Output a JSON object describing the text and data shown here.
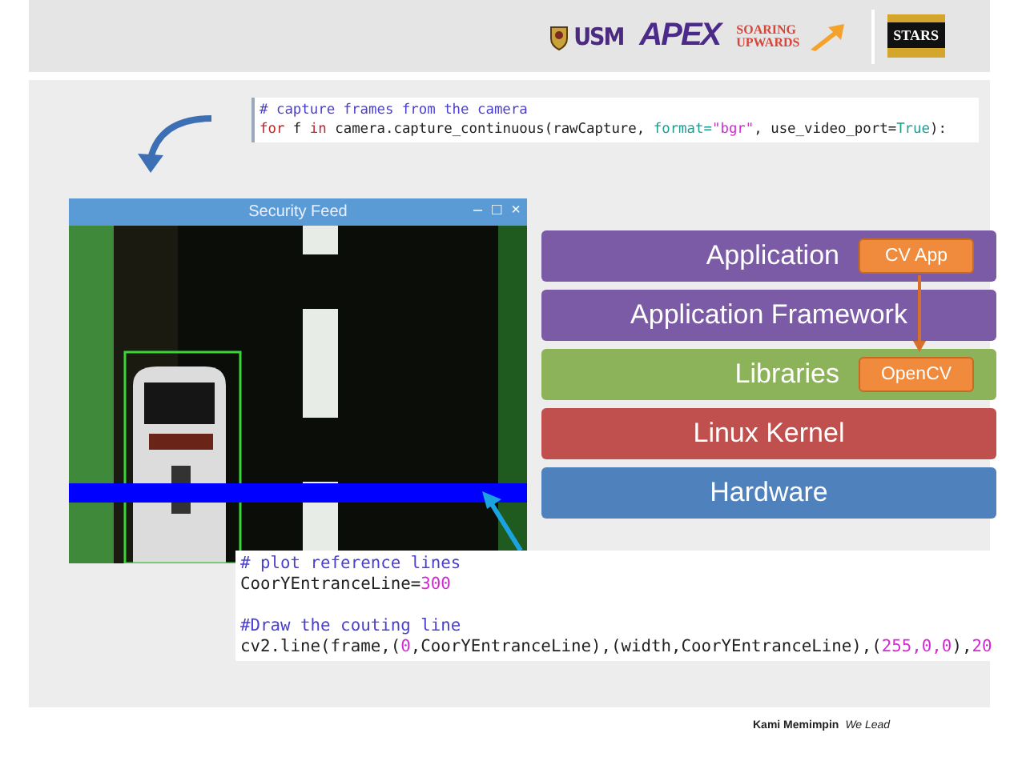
{
  "header": {
    "logos": [
      {
        "kind": "crest",
        "text": "USM"
      },
      {
        "kind": "apex",
        "text": "APEX"
      },
      {
        "kind": "soaring",
        "text": "SOARING UPWARDS"
      },
      {
        "kind": "stars",
        "text": "STARS"
      }
    ]
  },
  "code_top": {
    "blocks": [
      {
        "lines": [
          [
            {
              "kind": "comment",
              "text": "# capture frames from the camera"
            }
          ],
          [
            {
              "kind": "keyword",
              "text": "for"
            },
            {
              "kind": "plain",
              "text": " f "
            },
            {
              "kind": "keyword",
              "text": "in"
            },
            {
              "kind": "plain",
              "text": " camera.capture_continuous(rawCapture, "
            },
            {
              "kind": "param",
              "text": "format="
            },
            {
              "kind": "string",
              "text": "\"bgr\""
            },
            {
              "kind": "plain",
              "text": ", use_video_port="
            },
            {
              "kind": "param",
              "text": "True"
            },
            {
              "kind": "plain",
              "text": "):"
            }
          ]
        ]
      }
    ]
  },
  "feed_window": {
    "title": "Security Feed",
    "controls": [
      "–",
      "□",
      "×"
    ]
  },
  "stack": [
    {
      "label": "Application",
      "color": "#7b5ba6",
      "badge": "CV App"
    },
    {
      "label": "Application Framework",
      "color": "#7b5ba6"
    },
    {
      "label": "Libraries",
      "color": "#8cb35a",
      "badge": "OpenCV"
    },
    {
      "label": "Linux Kernel",
      "color": "#c0504d"
    },
    {
      "label": "Hardware",
      "color": "#4f81bd"
    }
  ],
  "code_bottom": {
    "blocks": [
      {
        "lines": [
          [
            {
              "kind": "comment",
              "text": "# plot reference lines"
            }
          ],
          [
            {
              "kind": "plain",
              "text": "CoorYEntranceLine="
            },
            {
              "kind": "number",
              "text": "300"
            }
          ]
        ]
      },
      {
        "lines": [
          [
            {
              "kind": "comment",
              "text": "#Draw the couting line"
            }
          ],
          [
            {
              "kind": "plain",
              "text": "cv2.line(frame,("
            },
            {
              "kind": "number",
              "text": "0"
            },
            {
              "kind": "plain",
              "text": ",CoorYEntranceLine),(width,CoorYEntranceLine),("
            },
            {
              "kind": "number",
              "text": "255,0,0"
            },
            {
              "kind": "plain",
              "text": "),"
            },
            {
              "kind": "number",
              "text": "20"
            }
          ]
        ]
      }
    ]
  },
  "footer": {
    "motto": "Kami Memimpin",
    "tagline": "We Lead"
  }
}
